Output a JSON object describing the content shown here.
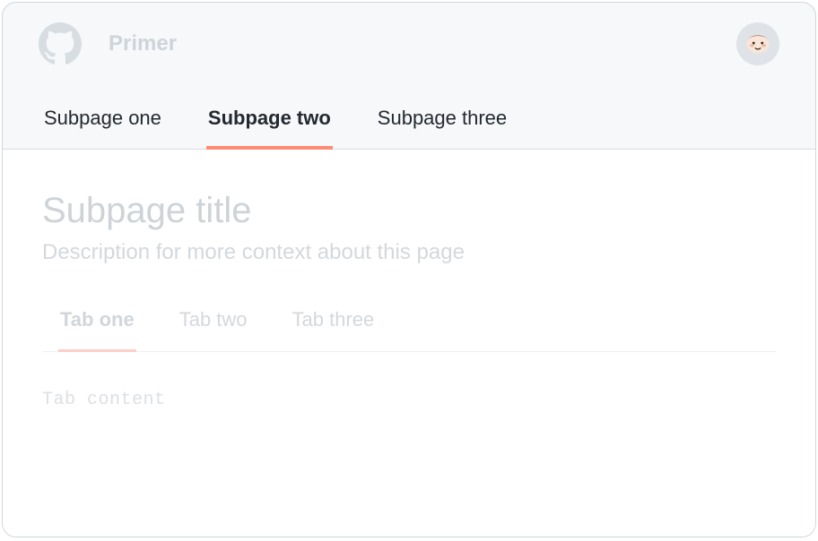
{
  "header": {
    "brand": "Primer"
  },
  "nav": {
    "items": [
      {
        "label": "Subpage one"
      },
      {
        "label": "Subpage two"
      },
      {
        "label": "Subpage three"
      }
    ],
    "active_index": 1
  },
  "page": {
    "title": "Subpage title",
    "description": "Description for more context about this page"
  },
  "tabs": {
    "items": [
      {
        "label": "Tab one"
      },
      {
        "label": "Tab two"
      },
      {
        "label": "Tab three"
      }
    ],
    "active_index": 0,
    "content": "Tab content"
  }
}
